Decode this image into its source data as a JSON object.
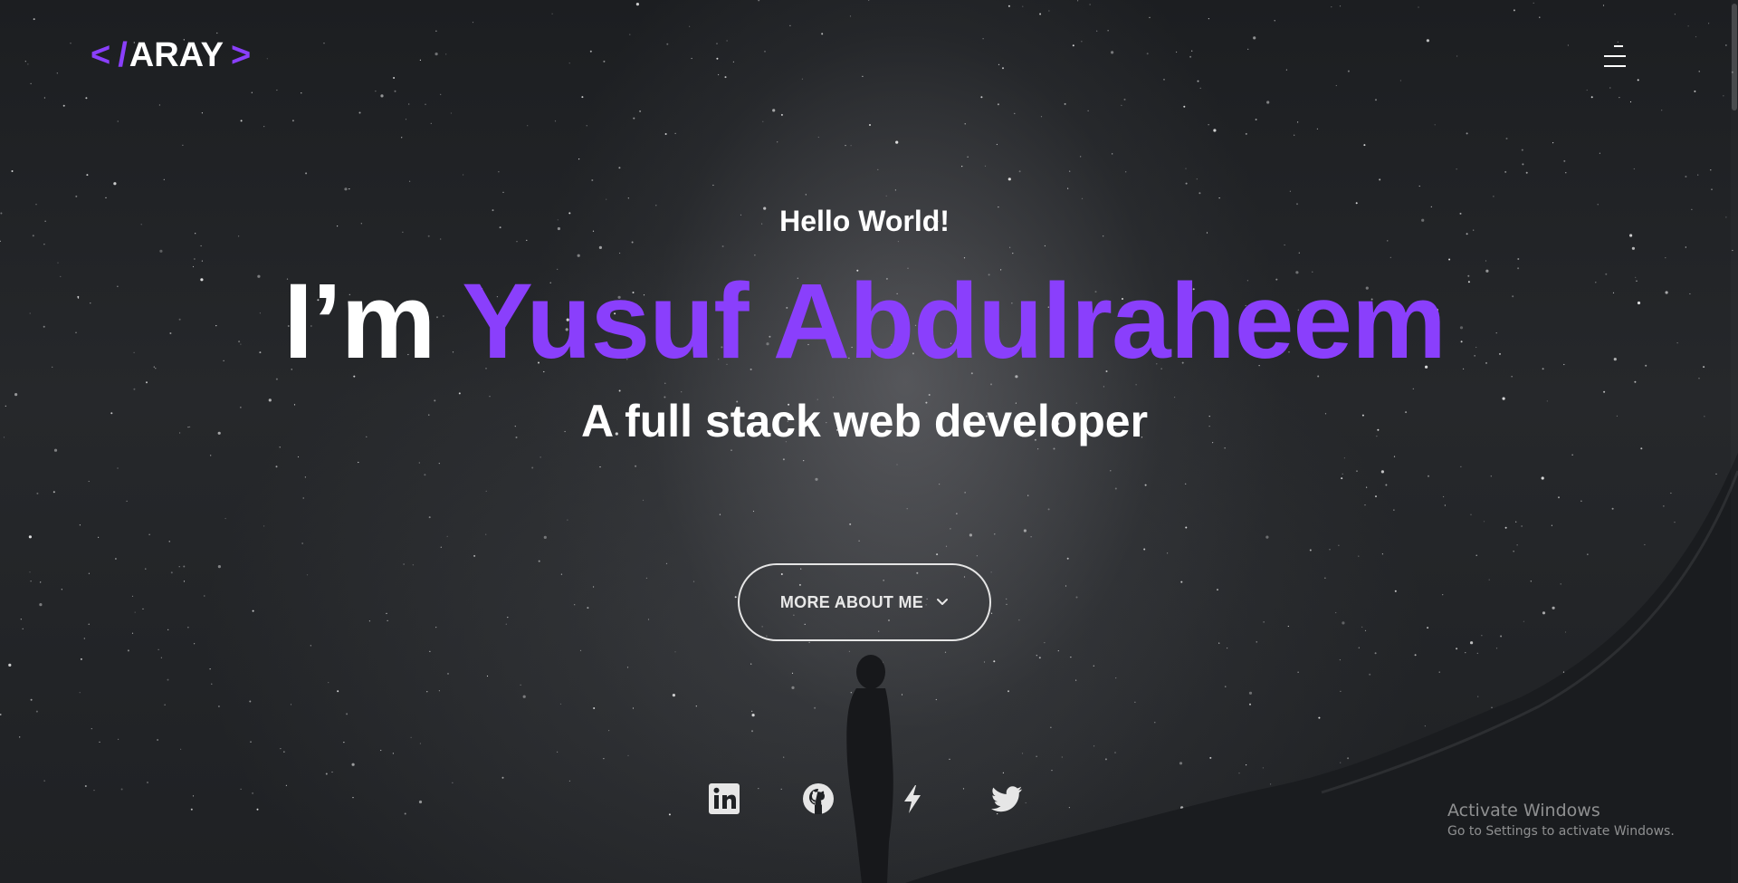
{
  "header": {
    "logo": {
      "open_bracket": "<",
      "slash": "/",
      "name": "ARAY",
      "close_bracket": ">"
    },
    "menu_icon": "hamburger-menu-icon"
  },
  "hero": {
    "greeting": "Hello World!",
    "headline_prefix": "I’m ",
    "headline_name": "Yusuf Abdulraheem",
    "subtitle": "A full stack web developer",
    "cta_label": "MORE ABOUT ME",
    "cta_icon": "chevron-down-icon"
  },
  "social": [
    {
      "icon": "linkedin-icon"
    },
    {
      "icon": "github-icon"
    },
    {
      "icon": "lightning-icon"
    },
    {
      "icon": "twitter-icon"
    }
  ],
  "os_watermark": {
    "title": "Activate Windows",
    "subtitle": "Go to Settings to activate Windows."
  },
  "colors": {
    "accent": "#8a3ffc",
    "background": "#1b1d20",
    "text": "#ffffff"
  }
}
